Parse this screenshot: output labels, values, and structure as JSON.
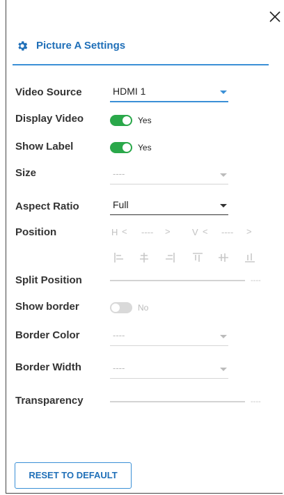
{
  "header": {
    "title": "Picture A Settings"
  },
  "rows": {
    "video_source": {
      "label": "Video Source",
      "value": "HDMI 1"
    },
    "display_video": {
      "label": "Display Video",
      "state": "Yes"
    },
    "show_label": {
      "label": "Show Label",
      "state": "Yes"
    },
    "size": {
      "label": "Size",
      "value": "----"
    },
    "aspect_ratio": {
      "label": "Aspect Ratio",
      "value": "Full"
    },
    "position": {
      "label": "Position",
      "h_prefix": "H",
      "h_value": "----",
      "v_prefix": "V",
      "v_value": "----"
    },
    "split_position": {
      "label": "Split Position",
      "value": "----"
    },
    "show_border": {
      "label": "Show border",
      "state": "No"
    },
    "border_color": {
      "label": "Border Color",
      "value": "----"
    },
    "border_width": {
      "label": "Border Width",
      "value": "----"
    },
    "transparency": {
      "label": "Transparency",
      "value": "----"
    }
  },
  "reset_button": {
    "label": "RESET TO DEFAULT"
  },
  "colors": {
    "accent": "#1f6fb8",
    "toggle_on": "#2aa84a",
    "disabled": "#c2c2c2"
  }
}
